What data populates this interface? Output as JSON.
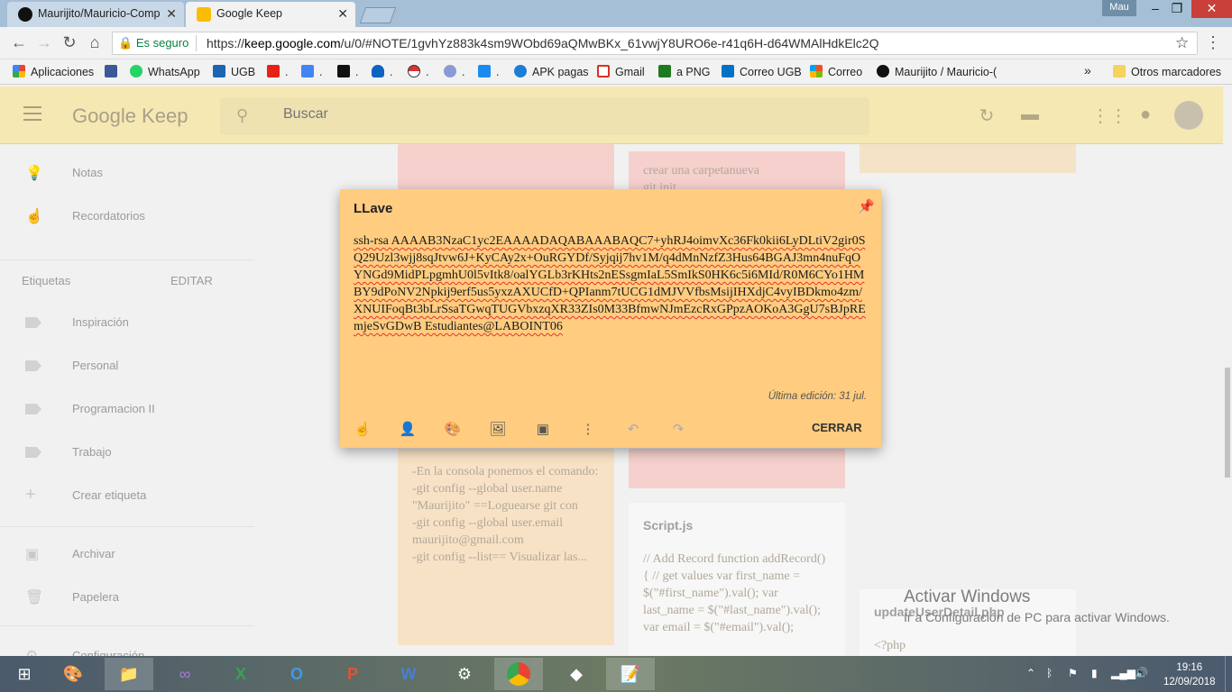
{
  "browser": {
    "tabs": [
      {
        "title": "Maurijito/Mauricio-Comp",
        "icon": "github-icon"
      },
      {
        "title": "Google Keep",
        "icon": "keep-icon"
      }
    ],
    "profile": "Mau",
    "secure_label": "Es seguro",
    "url_prefix": "https://",
    "url_domain": "keep.google.com",
    "url_path": "/u/0/#NOTE/1gvhYz883k4sm9WObd69aQMwBKx_61vwjY8URO6e-r41q6H-d64WMAlHdkElc2Q"
  },
  "bookmarks": {
    "items": [
      {
        "label": "Aplicaciones",
        "color": "#d44"
      },
      {
        "label": "",
        "color": "#3b5998"
      },
      {
        "label": "WhatsApp",
        "color": "#25d366"
      },
      {
        "label": "UGB",
        "color": "#1b65b3"
      },
      {
        "label": ".",
        "color": "#e62117"
      },
      {
        "label": ".",
        "color": "#4285f4"
      },
      {
        "label": ".",
        "color": "#111"
      },
      {
        "label": ".",
        "color": "#0e63c0"
      },
      {
        "label": ".",
        "color": "#d33"
      },
      {
        "label": ".",
        "color": "#8a9ad6"
      },
      {
        "label": ".",
        "color": "#1a8cf0"
      },
      {
        "label": "APK pagas",
        "color": "#1c7ed6"
      },
      {
        "label": "Gmail",
        "color": "#d93025"
      },
      {
        "label": "a PNG",
        "color": "#1f7a1f"
      },
      {
        "label": "Correo UGB",
        "color": "#0072c6"
      },
      {
        "label": "Correo",
        "color": "#f25022"
      },
      {
        "label": "Maurijito / Mauricio-(",
        "color": "#111"
      }
    ],
    "overflow": "»",
    "other": "Otros marcadores"
  },
  "keep": {
    "logo": "Google Keep",
    "search_placeholder": "Buscar",
    "sidebar": {
      "notes": "Notas",
      "reminders": "Recordatorios",
      "labels_heading": "Etiquetas",
      "edit": "EDITAR",
      "labels": [
        "Inspiración",
        "Personal",
        "Programacion II",
        "Trabajo"
      ],
      "create_label": "Crear etiqueta",
      "archive": "Archivar",
      "trash": "Papelera",
      "settings": "Configuración"
    }
  },
  "notes": {
    "git_top": "crear una carpetanueva\ngit init",
    "git_config": "-En la consola ponemos el comando:\n-git config --global user.name \"Maurijito\" ==Loguearse git con\n-git config --global user.email maurijito@gmail.com\n-git config --list== Visualizar las...",
    "script_title": "Script.js",
    "script_body": "// Add Record function addRecord() {    // get values var first_name = $(\"#first_name\").val();    var last_name = $(\"#last_name\").val();    var email = $(\"#email\").val();",
    "php_title": "updateUserDetail.php",
    "php_body": "<?php\ninclude(\"ajax/db_connection.php\");"
  },
  "dialog": {
    "title": "LLave",
    "body": "ssh-rsa AAAAB3NzaC1yc2EAAAADAQABAAABAQC7+yhRJ4oimvXc36Fk0kii6LyDLtiV2gir0SQ29Uzl3wjj8sqJtvw6J+KyCAy2x+OuRGYDf/Syjqij7hv1M/q4dMnNzfZ3Hus64BGAJ3mn4nuFqOYNGd9MidPLpgmhU0l5vItk8/oalYGLb3rKHts2nESsgmIaL5SmIkS0HK6c5i6MId/R0M6CYo1HMBY9dPoNV2Npkij9erf5us5yxzAXUCfD+QPIanm7tUCG1dMJVVfbsMsijIHXdjC4vyIBDkmo4zm/XNUIFoqBt3bLrSsaTGwqTUGVbxzqXR33ZIs0M33BfmwNJmEzcRxGPpzAOKoA3GgU7sBJpREmjeSvGDwB Estudiantes@LABOINT06",
    "edited": "Última edición: 31 jul.",
    "close": "CERRAR"
  },
  "watermark": {
    "line1": "Activar Windows",
    "line2": "Ir a Configuración de PC para activar Windows."
  },
  "taskbar": {
    "time": "19:16",
    "date": "12/09/2018"
  }
}
